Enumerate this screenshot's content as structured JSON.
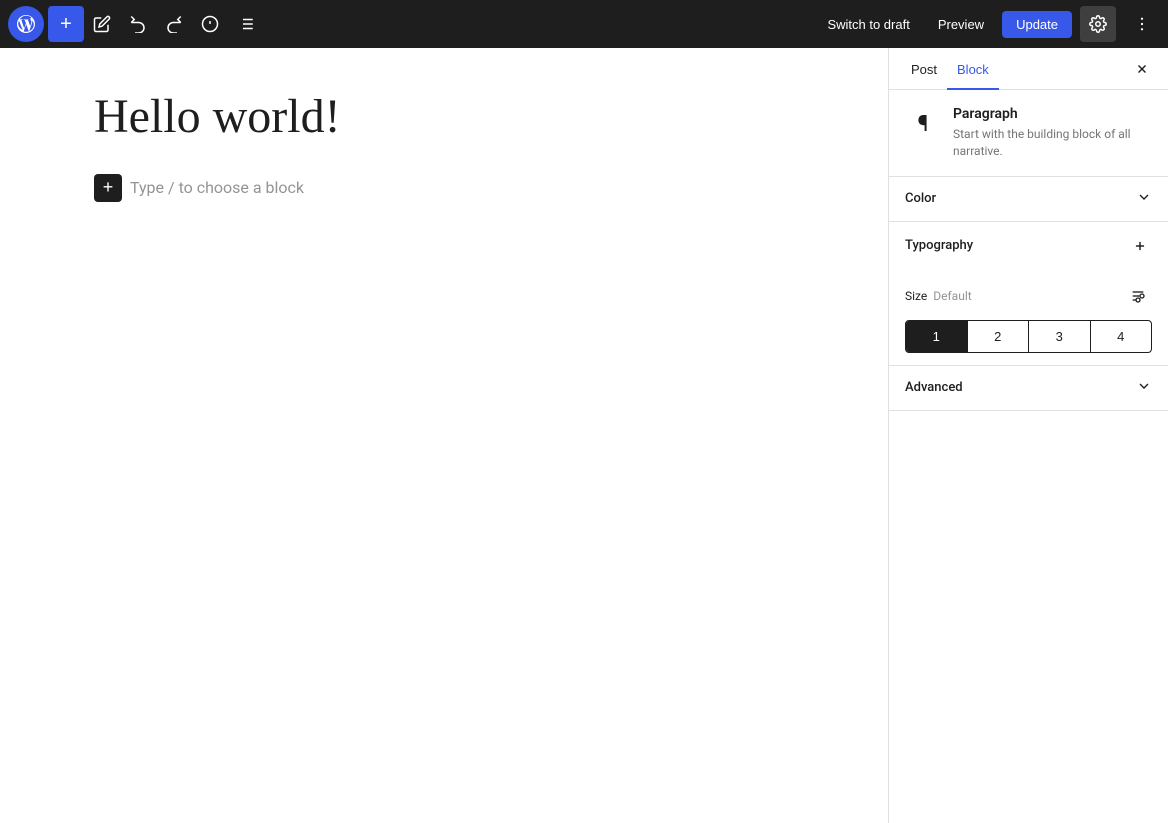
{
  "toolbar": {
    "add_label": "+",
    "undo_label": "↩",
    "redo_label": "↪",
    "info_label": "ℹ",
    "list_label": "≡",
    "switch_draft_label": "Switch to draft",
    "preview_label": "Preview",
    "update_label": "Update",
    "settings_icon": "⚙",
    "more_icon": "⋮"
  },
  "editor": {
    "post_title": "Hello world!",
    "block_placeholder": "Type / to choose a block"
  },
  "sidebar": {
    "tab_post": "Post",
    "tab_block": "Block",
    "close_icon": "✕",
    "block_info": {
      "name": "Paragraph",
      "description": "Start with the building block of all narrative.",
      "icon": "¶"
    },
    "color_panel": {
      "title": "Color"
    },
    "typography_panel": {
      "title": "Typography",
      "size_label": "Size",
      "size_value": "Default",
      "sizes": [
        "1",
        "2",
        "3",
        "4"
      ]
    },
    "advanced_panel": {
      "title": "Advanced"
    }
  }
}
